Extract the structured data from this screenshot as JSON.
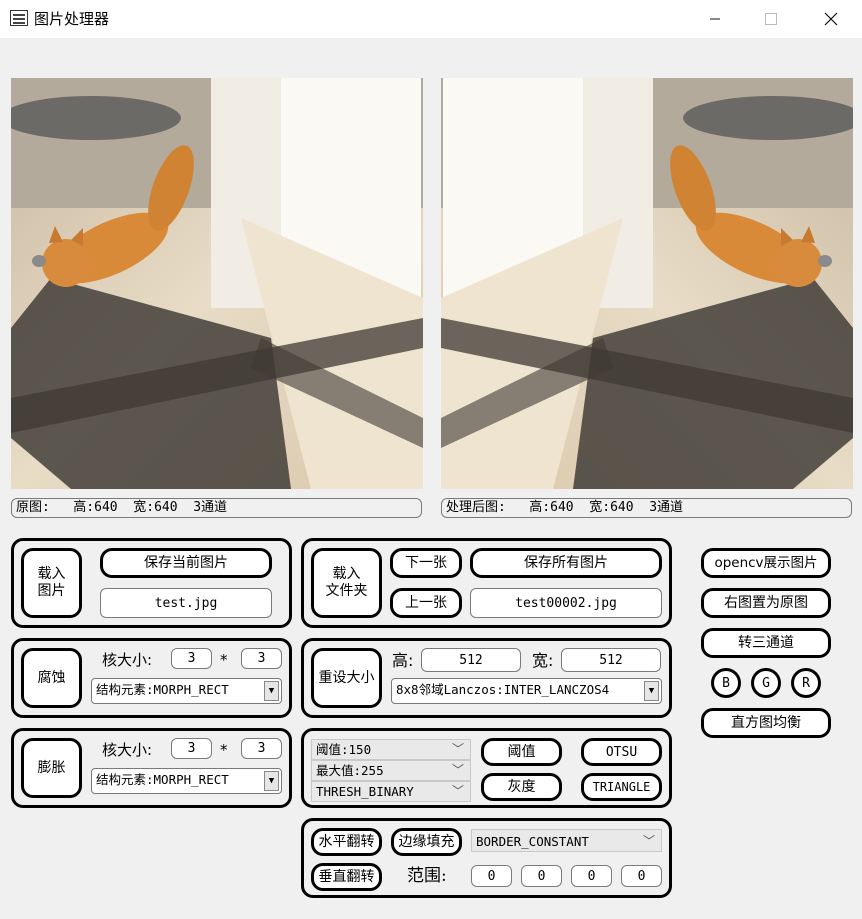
{
  "window": {
    "title": "图片处理器"
  },
  "info": {
    "original": "原图:   高:640  宽:640  3通道",
    "processed": "处理后图:   高:640  宽:640  3通道"
  },
  "load": {
    "load_image": "载入\n图片",
    "save_current": "保存当前图片",
    "filename": "test.jpg"
  },
  "folder": {
    "load_folder": "载入\n文件夹",
    "next": "下一张",
    "prev": "上一张",
    "save_all": "保存所有图片",
    "filename": "test00002.jpg"
  },
  "erode": {
    "button": "腐蚀",
    "kernel_label": "核大小:",
    "kernel_w": "3",
    "times": "*",
    "kernel_h": "3",
    "struct": "结构元素:MORPH_RECT"
  },
  "dilate": {
    "button": "膨胀",
    "kernel_label": "核大小:",
    "kernel_w": "3",
    "times": "*",
    "kernel_h": "3",
    "struct": "结构元素:MORPH_RECT"
  },
  "resize": {
    "button": "重设大小",
    "height_label": "高:",
    "height": "512",
    "width_label": "宽:",
    "width": "512",
    "interp": "8x8邻域Lanczos:INTER_LANCZOS4"
  },
  "threshold": {
    "thresh": "阈值:150",
    "maxval": "最大值:255",
    "type": "THRESH_BINARY",
    "thresh_button": "阈值",
    "otsu": "OTSU",
    "gray": "灰度",
    "triangle": "TRIANGLE"
  },
  "flip": {
    "horizontal": "水平翻转",
    "vertical": "垂直翻转",
    "border": "边缘填充",
    "border_type": "BORDER_CONSTANT",
    "range_label": "范围:",
    "ranges": [
      "0",
      "0",
      "0",
      "0"
    ]
  },
  "right": {
    "opencv_show": "opencv展示图片",
    "set_original": "右图置为原图",
    "to_three": "转三通道",
    "b": "B",
    "g": "G",
    "r": "R",
    "hist_eq": "直方图均衡"
  }
}
